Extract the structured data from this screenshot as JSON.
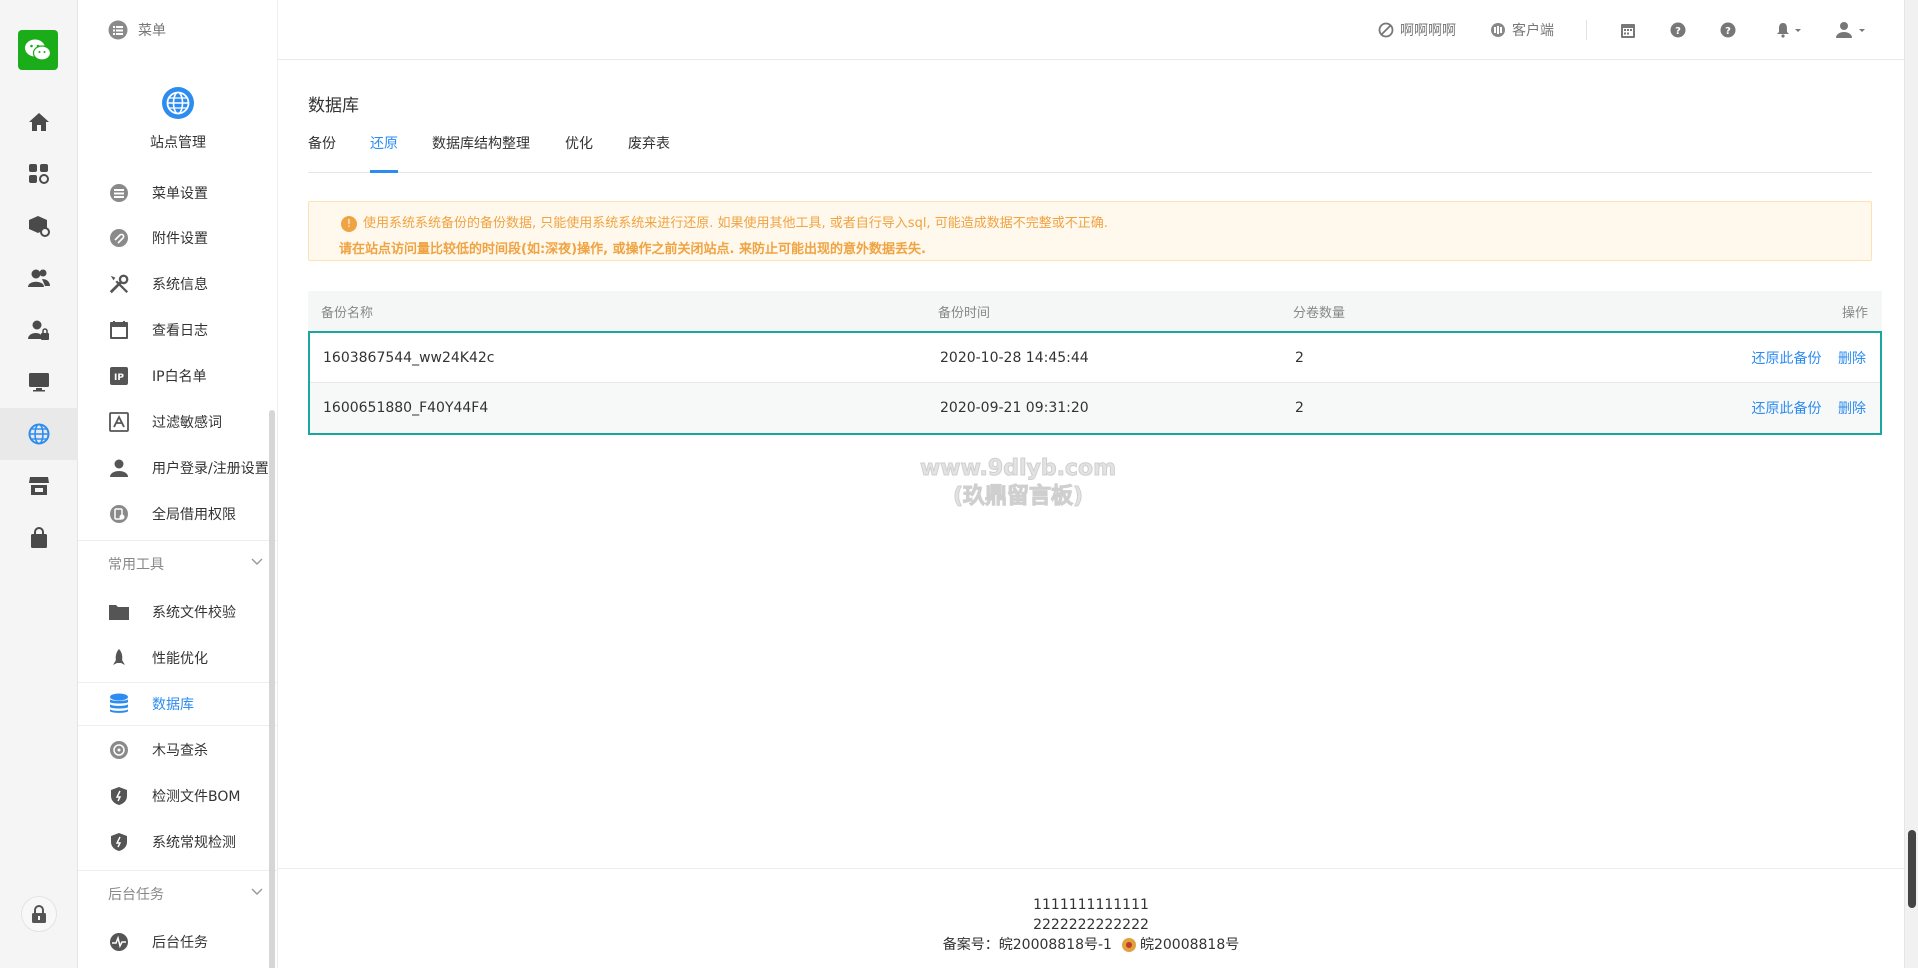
{
  "header": {
    "menu_label": "菜单",
    "user_label": "啊啊啊啊",
    "client_label": "客户端"
  },
  "sidebar": {
    "site_label": "站点管理",
    "items": [
      {
        "label": "菜单设置"
      },
      {
        "label": "附件设置"
      },
      {
        "label": "系统信息"
      },
      {
        "label": "查看日志"
      },
      {
        "label": "IP白名单"
      },
      {
        "label": "过滤敏感词"
      },
      {
        "label": "用户登录/注册设置"
      },
      {
        "label": "全局借用权限"
      }
    ],
    "group_tools": "常用工具",
    "tools": [
      {
        "label": "系统文件校验"
      },
      {
        "label": "性能优化"
      },
      {
        "label": "数据库"
      },
      {
        "label": "木马查杀"
      },
      {
        "label": "检测文件BOM"
      },
      {
        "label": "系统常规检测"
      }
    ],
    "group_tasks": "后台任务",
    "tasks": [
      {
        "label": "后台任务"
      }
    ]
  },
  "main": {
    "title": "数据库",
    "tabs": [
      {
        "label": "备份"
      },
      {
        "label": "还原"
      },
      {
        "label": "数据库结构整理"
      },
      {
        "label": "优化"
      },
      {
        "label": "废弃表"
      }
    ],
    "alert_line1": "使用系统系统备份的备份数据, 只能使用系统系统来进行还原. 如果使用其他工具, 或者自行导入sql, 可能造成数据不完整或不正确.",
    "alert_line2": "请在站点访问量比较低的时间段(如:深夜)操作, 或操作之前关闭站点. 来防止可能出现的意外数据丢失.",
    "table": {
      "columns": [
        "备份名称",
        "备份时间",
        "分卷数量",
        "操作"
      ],
      "rows": [
        {
          "name": "1603867544_ww24K42c",
          "time": "2020-10-28 14:45:44",
          "volumes": "2",
          "restore": "还原此备份",
          "delete": "删除"
        },
        {
          "name": "1600651880_F40Y44F4",
          "time": "2020-09-21 09:31:20",
          "volumes": "2",
          "restore": "还原此备份",
          "delete": "删除"
        }
      ]
    },
    "watermark_line1": "www.9dlyb.com",
    "watermark_line2": "(玖鼎留言板)"
  },
  "footer": {
    "line1": "1111111111111",
    "line2": "2222222222222",
    "beian": "备案号：皖20008818号-1",
    "police": "皖20008818号"
  },
  "colors": {
    "accent": "#2d8cf0",
    "alert_text": "#f0a342",
    "table_border": "#1aa7a0",
    "wechat_green": "#1aad19"
  }
}
